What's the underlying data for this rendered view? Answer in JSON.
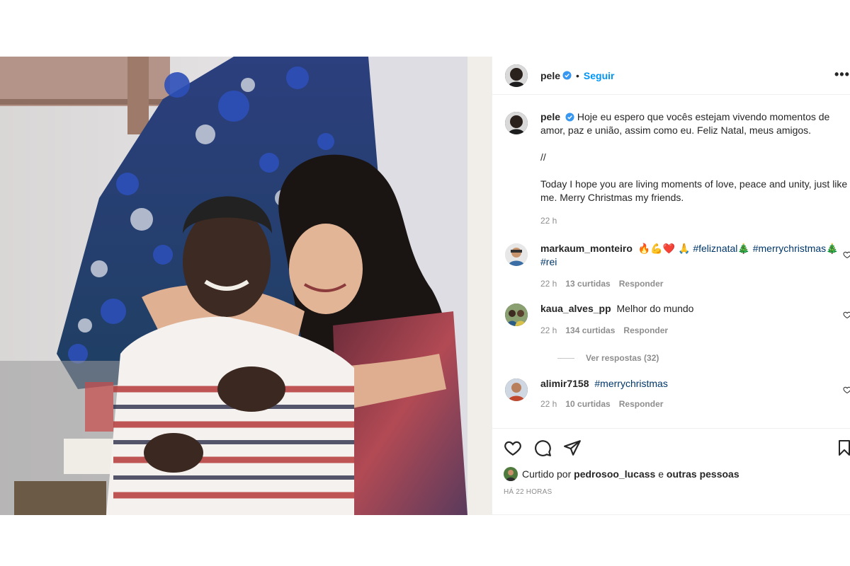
{
  "post": {
    "author": "pele",
    "follow_label": "Seguir",
    "dot_separator": "•",
    "more_label": "•••",
    "caption": {
      "pt": "Hoje eu espero que vocês estejam vivendo momentos de amor, paz e união, assim como eu. Feliz Natal, meus amigos.",
      "separator": "//",
      "en": "Today I hope you are living moments of love, peace and unity, just like me. Merry Christmas my friends.",
      "time": "22 h"
    },
    "comments": [
      {
        "username": "markaum_monteiro",
        "emojis": "🔥💪❤️ 🙏",
        "hashtag1": "#feliznatal🎄",
        "hashtag2": "#merrychristmas🎄",
        "hashtag3": "#rei",
        "time": "22 h",
        "likes": "13 curtidas",
        "reply": "Responder"
      },
      {
        "username": "kaua_alves_pp",
        "text": "Melhor do mundo",
        "time": "22 h",
        "likes": "134 curtidas",
        "reply": "Responder",
        "view_replies": "Ver respostas (32)"
      },
      {
        "username": "alimir7158",
        "hashtag1": "#merrychristmas",
        "time": "22 h",
        "likes": "10 curtidas",
        "reply": "Responder"
      }
    ],
    "liked_by": {
      "prefix": "Curtido por",
      "user": "pedrosoo_lucass",
      "conj": "e",
      "others": "outras pessoas"
    },
    "timestamp": "HÁ 22 HORAS",
    "colors": {
      "accent": "#0095f6",
      "hashtag": "#00376b",
      "muted": "#8e8e8e",
      "border": "#efefef"
    },
    "icons": [
      "heart-icon",
      "comment-icon",
      "share-icon",
      "bookmark-icon",
      "verified-icon",
      "more-icon"
    ]
  }
}
